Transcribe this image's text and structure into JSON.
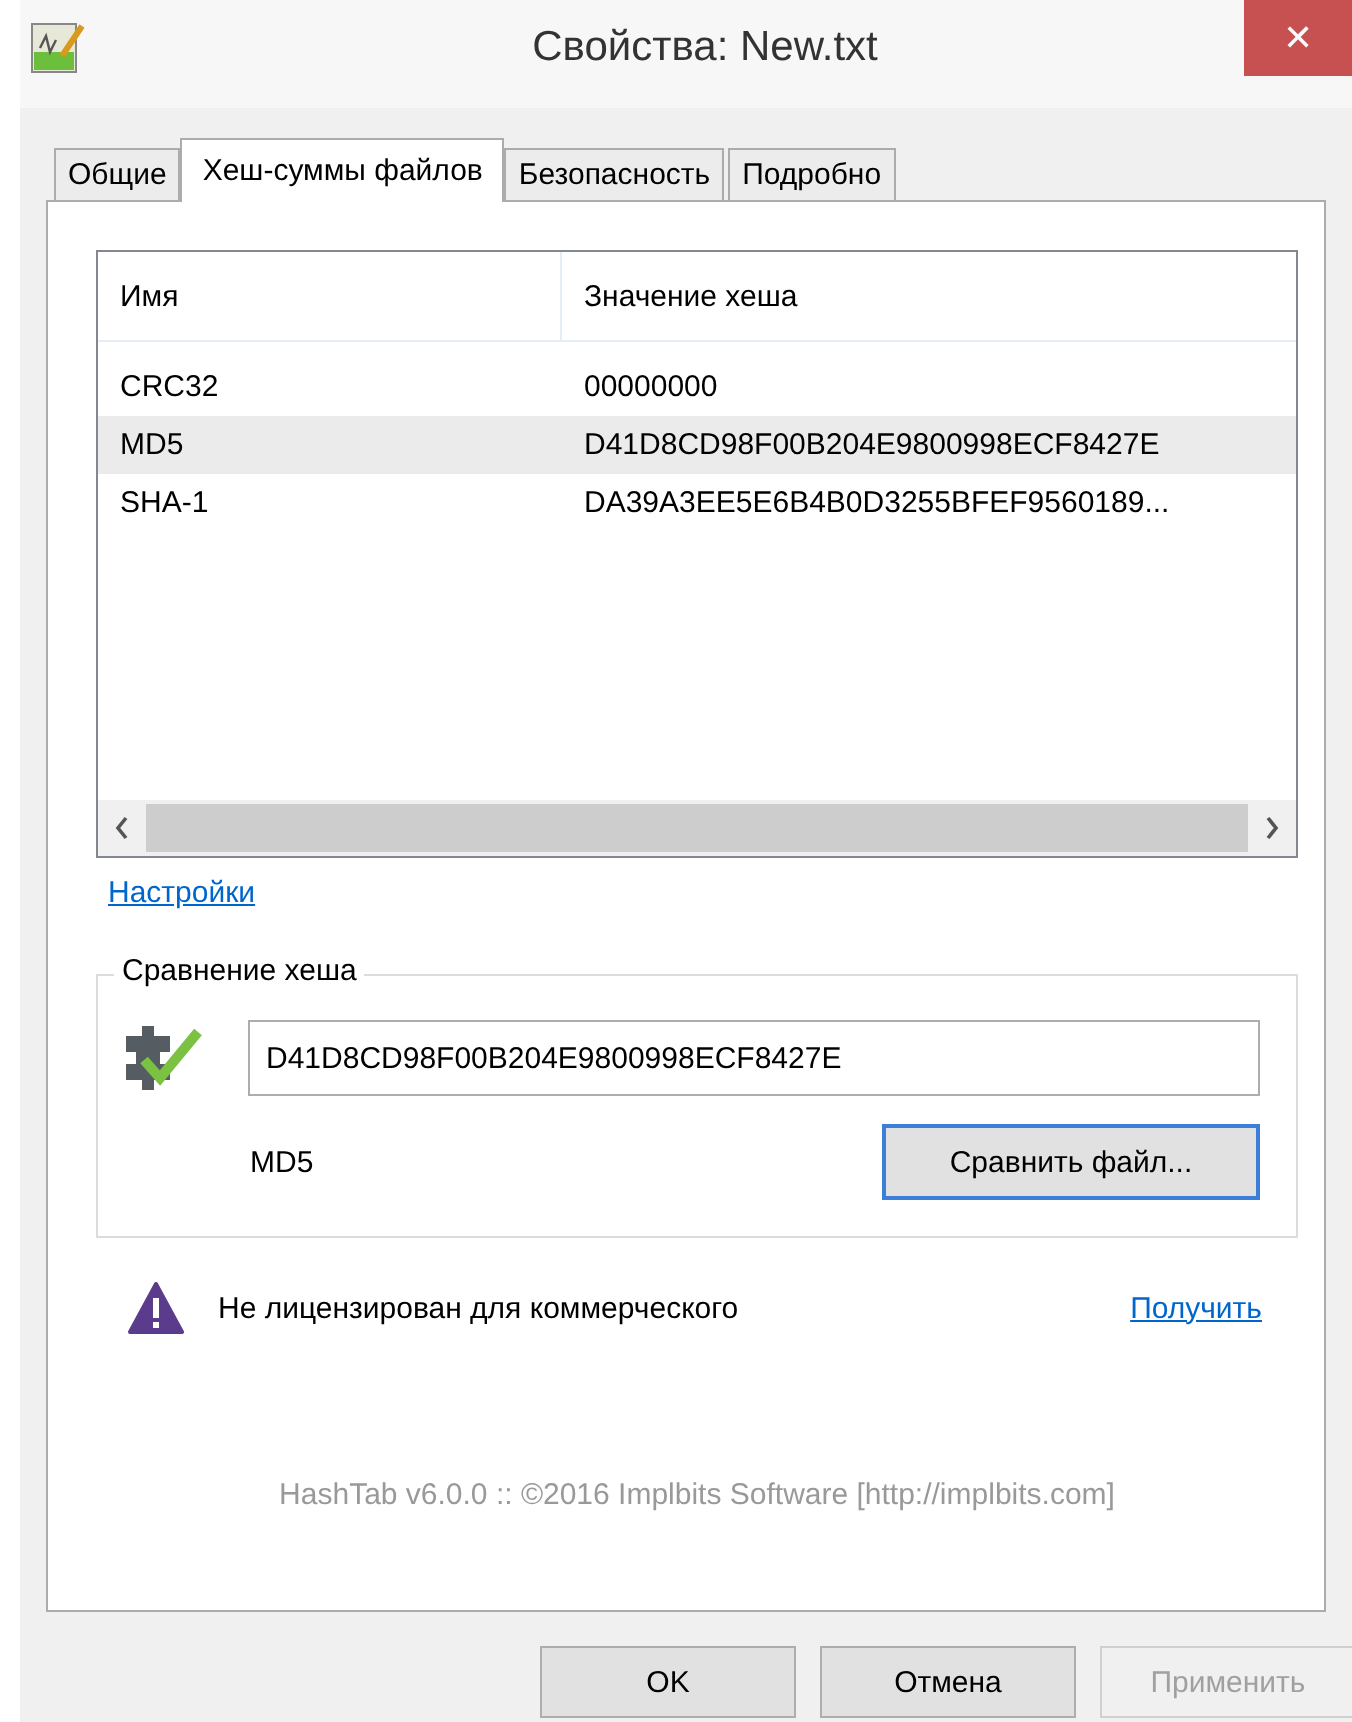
{
  "window": {
    "title": "Свойства: New.txt",
    "close": "✕"
  },
  "tabs": [
    {
      "label": "Общие",
      "selected": false
    },
    {
      "label": "Хеш-суммы файлов",
      "selected": true
    },
    {
      "label": "Безопасность",
      "selected": false
    },
    {
      "label": "Подробно",
      "selected": false
    }
  ],
  "hash_list": {
    "columns": [
      "Имя",
      "Значение хеша"
    ],
    "rows": [
      {
        "name": "CRC32",
        "value": "00000000",
        "selected": false
      },
      {
        "name": "MD5",
        "value": "D41D8CD98F00B204E9800998ECF8427E",
        "selected": true
      },
      {
        "name": "SHA-1",
        "value": "DA39A3EE5E6B4B0D3255BFEF9560189...",
        "selected": false
      }
    ]
  },
  "settings_link": "Настройки",
  "compare": {
    "title": "Сравнение хеша",
    "value": "D41D8CD98F00B204E9800998ECF8427E",
    "algorithm": "MD5",
    "button": "Сравнить файл..."
  },
  "license": {
    "message": "Не лицензирован для коммерческого",
    "link": "Получить"
  },
  "footer": "HashTab v6.0.0 :: ©2016 Implbits Software [http://implbits.com]",
  "buttons": [
    {
      "label": "OK",
      "disabled": false
    },
    {
      "label": "Отмена",
      "disabled": false
    },
    {
      "label": "Применить",
      "disabled": true
    }
  ]
}
